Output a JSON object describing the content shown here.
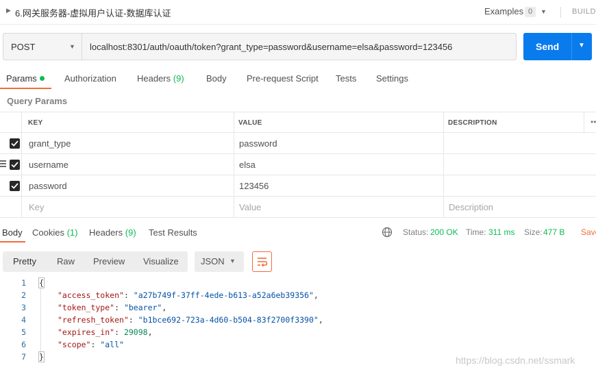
{
  "titlebar": {
    "title": "6.网关服务器-虚拟用户认证-数据库认证",
    "examples_label": "Examples",
    "examples_count": "0",
    "build_label": "BUILD"
  },
  "request": {
    "method": "POST",
    "url": "localhost:8301/auth/oauth/token?grant_type=password&username=elsa&password=123456",
    "send_label": "Send"
  },
  "request_tabs": {
    "params": "Params",
    "authorization": "Authorization",
    "headers": "Headers",
    "headers_count": "(9)",
    "body": "Body",
    "prerequest": "Pre-request Script",
    "tests": "Tests",
    "settings": "Settings"
  },
  "query_params": {
    "section_label": "Query Params",
    "headers": {
      "key": "KEY",
      "value": "VALUE",
      "description": "DESCRIPTION",
      "more": "•••"
    },
    "rows": [
      {
        "key": "grant_type",
        "value": "password",
        "checked": true
      },
      {
        "key": "username",
        "value": "elsa",
        "checked": true
      },
      {
        "key": "password",
        "value": "123456",
        "checked": true
      }
    ],
    "placeholders": {
      "key": "Key",
      "value": "Value",
      "description": "Description"
    }
  },
  "response_tabs": {
    "body": "Body",
    "cookies": "Cookies",
    "cookies_count": "(1)",
    "headers": "Headers",
    "headers_count": "(9)",
    "test_results": "Test Results"
  },
  "response_meta": {
    "status_label": "Status:",
    "status_value": "200 OK",
    "time_label": "Time:",
    "time_value": "311 ms",
    "size_label": "Size:",
    "size_value": "477 B",
    "save_label": "Save"
  },
  "view_modes": {
    "pretty": "Pretty",
    "raw": "Raw",
    "preview": "Preview",
    "visualize": "Visualize",
    "format": "JSON"
  },
  "response_body": {
    "line_numbers": [
      "1",
      "2",
      "3",
      "4",
      "5",
      "6",
      "7"
    ],
    "open_brace": "{",
    "close_brace": "}",
    "fields": [
      {
        "key": "\"access_token\"",
        "value": "\"a27b749f-37ff-4ede-b613-a52a6eb39356\"",
        "kind": "string"
      },
      {
        "key": "\"token_type\"",
        "value": "\"bearer\"",
        "kind": "string"
      },
      {
        "key": "\"refresh_token\"",
        "value": "\"b1bce692-723a-4d60-b504-83f2700f3390\"",
        "kind": "string"
      },
      {
        "key": "\"expires_in\"",
        "value": "29098",
        "kind": "number"
      },
      {
        "key": "\"scope\"",
        "value": "\"all\"",
        "kind": "string"
      }
    ]
  },
  "watermark": "https://blog.csdn.net/ssmark",
  "colors": {
    "accent": "#f26b3a",
    "send": "#097bed",
    "success": "#0cbb52"
  }
}
